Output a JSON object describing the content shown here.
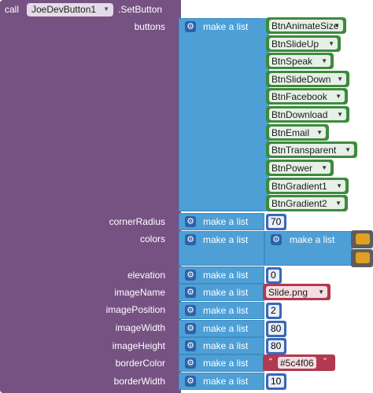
{
  "call": {
    "keyword": "call",
    "component": "JoeDevButton1",
    "method": ".SetButton"
  },
  "params": {
    "buttons": "buttons",
    "cornerRadius": "cornerRadius",
    "colors": "colors",
    "elevation": "elevation",
    "imageName": "imageName",
    "imagePosition": "imagePosition",
    "imageWidth": "imageWidth",
    "imageHeight": "imageHeight",
    "borderColor": "borderColor",
    "borderWidth": "borderWidth"
  },
  "make_list_label": "make a list",
  "buttons_list": [
    "BtnAnimateSize",
    "BtnSlideUp",
    "BtnSpeak",
    "BtnSlideDown",
    "BtnFacebook",
    "BtnDownload",
    "BtnEmail",
    "BtnTransparent",
    "BtnPower",
    "BtnGradient1",
    "BtnGradient2"
  ],
  "values": {
    "cornerRadius": "70",
    "elevation": "0",
    "imageName": "Slide.png",
    "imagePosition": "2",
    "imageWidth": "80",
    "imageHeight": "80",
    "borderColor": "#5c4f06",
    "borderWidth": "10"
  },
  "quote_open": "“",
  "quote_close": "”",
  "gear_glyph": "⚙",
  "dropdown_glyph": "▼",
  "colors": {
    "call_block": "#765283",
    "make_list": "#4e9fd6",
    "component": "#3d8a3d",
    "number": "#3b67b8",
    "text": "#b2394f",
    "color_swatch": "#e0a024"
  }
}
